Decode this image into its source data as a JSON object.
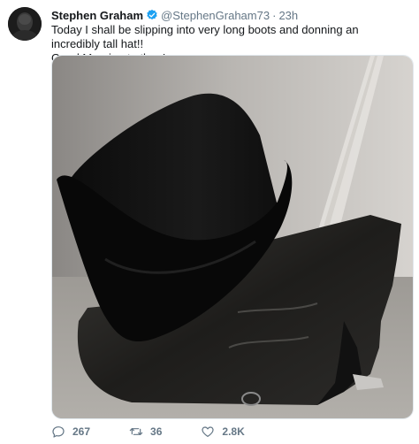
{
  "tweet": {
    "author_name": "Stephen Graham",
    "handle": "@StephenGraham73",
    "separator": "·",
    "time": "23h",
    "text_line1": "Today I shall be slipping into very long boots and donning an incredibly tall hat!!",
    "text_line2": "Good Morning to thee!",
    "verified_icon": "verified-badge-icon",
    "accent_color": "#1da1f2"
  },
  "actions": {
    "reply_count": "267",
    "retweet_count": "36",
    "like_count": "2.8K",
    "icons": [
      "reply-icon",
      "retweet-icon",
      "like-icon"
    ]
  }
}
